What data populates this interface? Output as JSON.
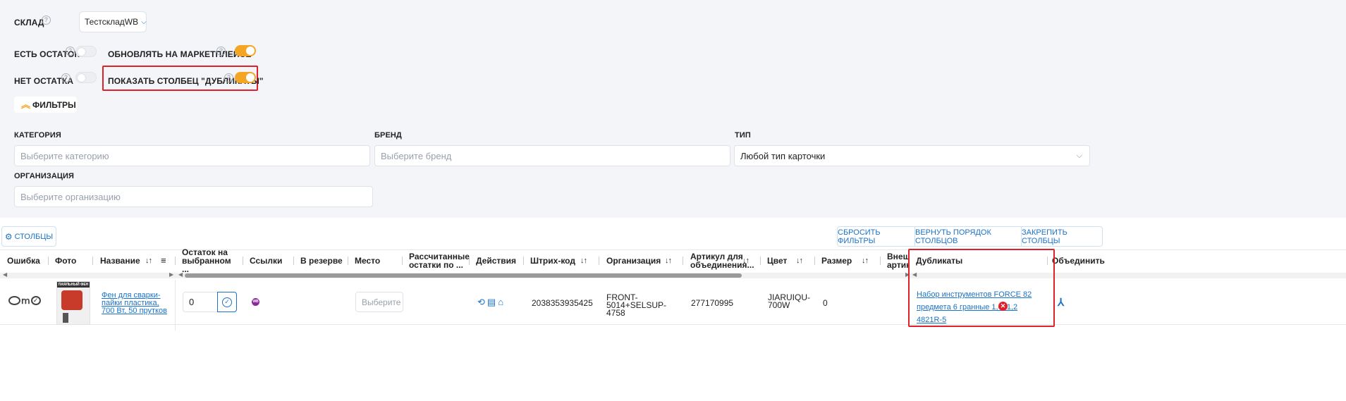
{
  "filters": {
    "warehouse_label": "СКЛАД",
    "warehouse_value": "ТестскладWB",
    "in_stock_label": "ЕСТЬ ОСТАТОК",
    "update_marketplace_label": "ОБНОВЛЯТЬ НА МАРКЕТПЛЕЙСЕ",
    "no_stock_label": "НЕТ ОСТАТКА",
    "show_duplicates_label": "ПОКАЗАТЬ СТОЛБЕЦ \"ДУБЛИКАТЫ\"",
    "filters_button": "ФИЛЬТРЫ",
    "category_label": "КАТЕГОРИЯ",
    "category_placeholder": "Выберите категорию",
    "brand_label": "БРЕНД",
    "brand_placeholder": "Выберите бренд",
    "type_label": "ТИП",
    "type_value": "Любой тип карточки",
    "org_label": "ОРГАНИЗАЦИЯ",
    "org_placeholder": "Выберите организацию",
    "help_glyph": "?"
  },
  "toolbar": {
    "columns_button": "СТОЛБЦЫ",
    "reset_filters": "СБРОСИТЬ ФИЛЬТРЫ",
    "restore_order": "ВЕРНУТЬ ПОРЯДОК СТОЛБЦОВ",
    "pin_columns": "ЗАКРЕПИТЬ СТОЛБЦЫ"
  },
  "table": {
    "headers": {
      "error": "Ошибка",
      "photo": "Фото",
      "name": "Название",
      "stock_selected": "Остаток на выбранном ...",
      "links": "Ссылки",
      "reserved": "В резерве",
      "place": "Место",
      "calc_stock": "Рассчитанные остатки по ...",
      "actions": "Действия",
      "barcode": "Штрих-код",
      "organization": "Организация",
      "article_merge": "Артикул для объединения...",
      "color": "Цвет",
      "size": "Размер",
      "external_article": "Внешн артику",
      "duplicates": "Дубликаты",
      "merge": "Объединить"
    },
    "sort_glyph": "↓↑",
    "row": {
      "product_name": "Фен для сварки-пайки пластика, 700 Вт, 50 прутков",
      "stock_value": "0",
      "link_badge": "WB",
      "place_placeholder": "Выберите ...",
      "barcode": "2038353935425",
      "organization": "FRONT-5014+SELSUP-4758",
      "article": "277170995",
      "color": "JIARUIQU-700W",
      "size": "0",
      "duplicate_link": "Набор инструментов FORCE 82 предмета 6 гранные 1,4, 1,2 4821R-5",
      "photo_text": "ПАЯЛЬНЫЙ ФЕН"
    }
  },
  "colors": {
    "accent_orange": "#f5a524",
    "link_blue": "#1a73c8",
    "highlight_red": "#e0202a"
  }
}
